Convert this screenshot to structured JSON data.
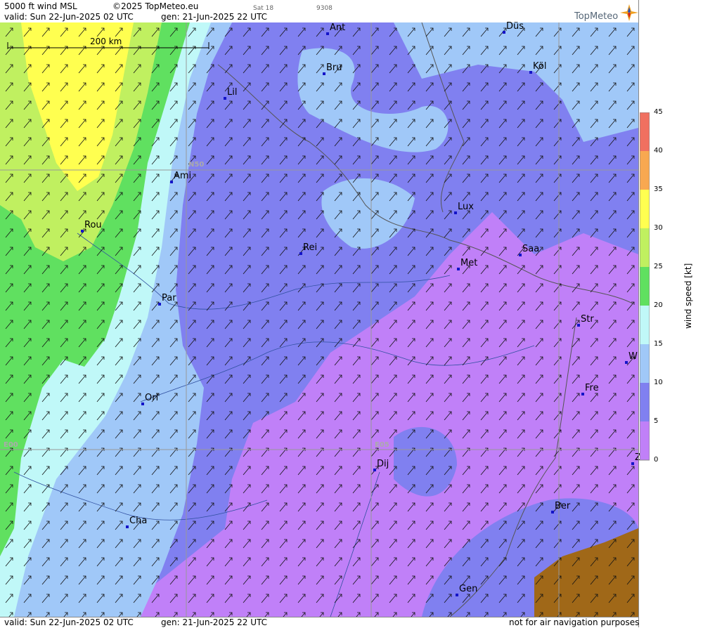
{
  "header": {
    "product": "5000 ft wind MSL",
    "copyright": "©2025 TopMeteo.eu",
    "sat": "Sat 18",
    "code": "9308",
    "valid": "valid:  Sun  22-Jun-2025  02 UTC",
    "gen": "gen: 21-Jun-2025 22 UTC"
  },
  "footer": {
    "valid": "valid:  Sun  22-Jun-2025  02 UTC",
    "gen": "gen: 21-Jun-2025 22 UTC",
    "disclaimer": "not for air navigation purposes"
  },
  "logo": {
    "text": "TopMeteo",
    "icon": "compass-star-icon"
  },
  "scale": {
    "label": "200 km"
  },
  "grid_labels": {
    "lat": "N50",
    "lon0": "E00",
    "lon5": "E05"
  },
  "cities": [
    {
      "name": "Ant"
    },
    {
      "name": "Düs"
    },
    {
      "name": "Bru"
    },
    {
      "name": "Köl"
    },
    {
      "name": "Lil"
    },
    {
      "name": "Ami"
    },
    {
      "name": "Lux"
    },
    {
      "name": "Rou"
    },
    {
      "name": "Rei"
    },
    {
      "name": "Saa"
    },
    {
      "name": "Met"
    },
    {
      "name": "Par"
    },
    {
      "name": "Str"
    },
    {
      "name": "W"
    },
    {
      "name": "Fre"
    },
    {
      "name": "Orl"
    },
    {
      "name": "Dij"
    },
    {
      "name": "Ber"
    },
    {
      "name": "Cha"
    },
    {
      "name": "Gen"
    },
    {
      "name": "Z"
    }
  ],
  "legend": {
    "title": "wind speed [kt]",
    "ticks": [
      "45",
      "40",
      "35",
      "30",
      "25",
      "20",
      "15",
      "10",
      "5",
      "0"
    ],
    "colors": [
      "#f07060",
      "#f8a850",
      "#ffff50",
      "#c0f060",
      "#60e060",
      "#c0f8f8",
      "#a0c8f8",
      "#8080f0",
      "#c080f8",
      "#ffffff"
    ]
  }
}
